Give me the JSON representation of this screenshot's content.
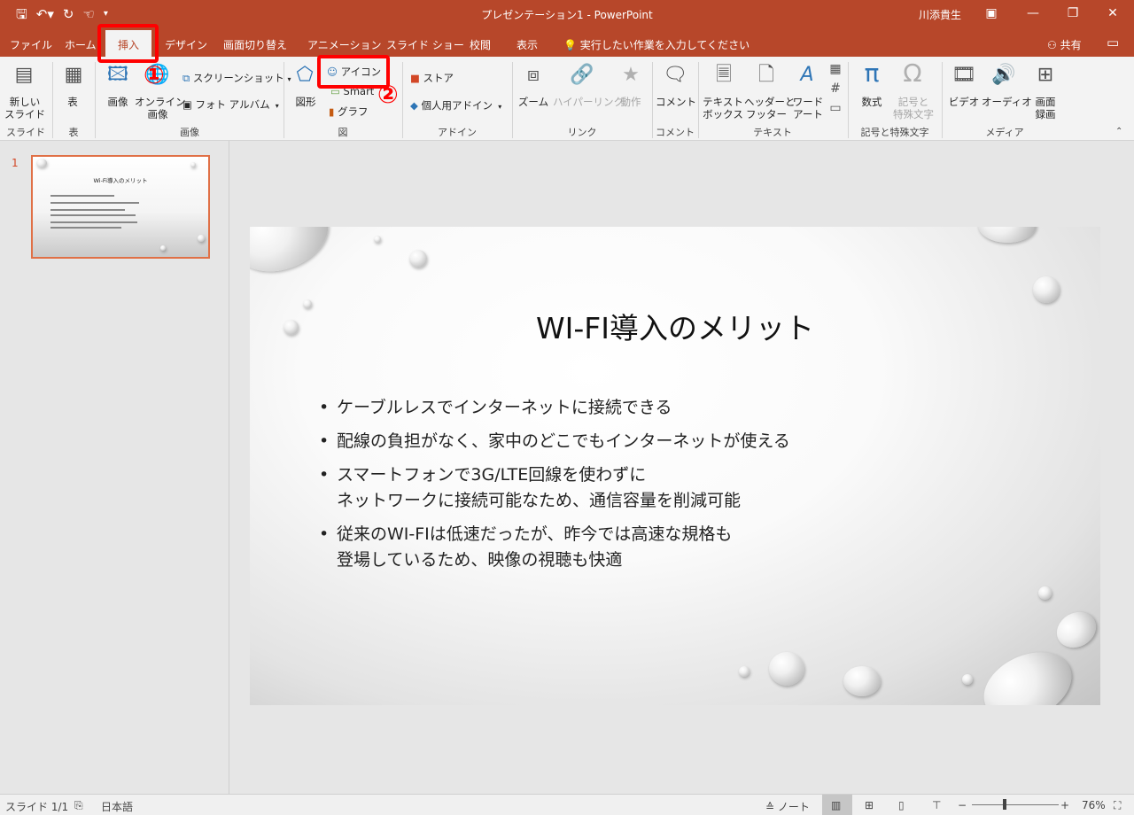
{
  "window": {
    "title": "プレゼンテーション1  -  PowerPoint",
    "user": "川添貴生",
    "qat_icons": [
      "save-icon",
      "undo-icon",
      "redo-icon",
      "touch-mode-icon",
      "customize-qat-icon"
    ]
  },
  "tabs": {
    "file": "ファイル",
    "home": "ホーム",
    "insert": "挿入",
    "design": "デザイン",
    "transitions": "画面切り替え",
    "animations": "アニメーション",
    "slideshow": "スライド ショー",
    "review": "校閲",
    "view": "表示",
    "tell_me": "実行したい作業を入力してください",
    "share": "共有"
  },
  "ribbon": {
    "new_slide": [
      "新しい",
      "スライド"
    ],
    "table": "表",
    "pictures": "画像",
    "online_pictures": [
      "オンライン",
      "画像"
    ],
    "screenshot": "スクリーンショット",
    "photo_album": "フォト アルバム",
    "shapes": "図形",
    "icons": "アイコン",
    "smartart": "Smart",
    "chart": "グラフ",
    "store": "ストア",
    "my_addins": "個人用アドイン",
    "zoom": "ズーム",
    "hyperlink": "ハイパーリンク",
    "action": "動作",
    "comment": "コメント",
    "textbox": [
      "テキスト",
      "ボックス"
    ],
    "header_footer": [
      "ヘッダーと",
      "フッター"
    ],
    "wordart": [
      "ワード",
      "アート"
    ],
    "equation": "数式",
    "symbol": [
      "記号と",
      "特殊文字"
    ],
    "video": "ビデオ",
    "audio": "オーディオ",
    "screen_recording": [
      "画面",
      "録画"
    ],
    "groups": {
      "slides": "スライド",
      "tables": "表",
      "images": "画像",
      "illustrations": "図",
      "addins": "アドイン",
      "links": "リンク",
      "comments": "コメント",
      "text": "テキスト",
      "symbols": "記号と特殊文字",
      "media": "メディア"
    }
  },
  "annotations": {
    "step1": "①",
    "step2": "②",
    "color": "#ff0000"
  },
  "thumbnail": {
    "number": "1",
    "title": "Wi-Fi導入のメリット"
  },
  "slide": {
    "title": "WI-FI導入のメリット",
    "bullets": [
      [
        "ケーブルレスでインターネットに接続できる"
      ],
      [
        "配線の負担がなく、家中のどこでもインターネットが使える"
      ],
      [
        "スマートフォンで3G/LTE回線を使わずに",
        "ネットワークに接続可能なため、通信容量を削減可能"
      ],
      [
        "従来のWI-FIは低速だったが、昨今では高速な規格も",
        "登場しているため、映像の視聴も快適"
      ]
    ]
  },
  "statusbar": {
    "slide_count": "スライド 1/1",
    "language": "日本語",
    "notes": "ノート",
    "zoom_level": "76%",
    "zoom_fraction": 0.38
  },
  "colors": {
    "accent": "#b7472a",
    "ribbon_bg": "#f3f3f3",
    "thumbnail_border": "#e07046"
  }
}
